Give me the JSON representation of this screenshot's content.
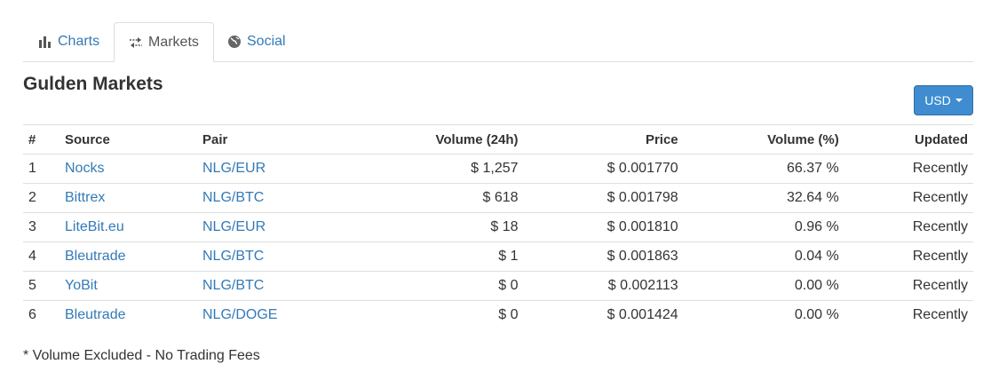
{
  "tabs": [
    {
      "label": "Charts",
      "icon": "bar-chart-icon",
      "active": false
    },
    {
      "label": "Markets",
      "icon": "exchange-arrows-icon",
      "active": true
    },
    {
      "label": "Social",
      "icon": "globe-icon",
      "active": false
    }
  ],
  "heading": "Gulden Markets",
  "currency_button": {
    "label": "USD"
  },
  "table": {
    "headers": [
      "#",
      "Source",
      "Pair",
      "Volume (24h)",
      "Price",
      "Volume (%)",
      "Updated"
    ],
    "rows": [
      {
        "num": "1",
        "source": "Nocks",
        "pair": "NLG/EUR",
        "volume": "$ 1,257",
        "price": "$ 0.001770",
        "volume_pct": "66.37 %",
        "updated": "Recently"
      },
      {
        "num": "2",
        "source": "Bittrex",
        "pair": "NLG/BTC",
        "volume": "$ 618",
        "price": "$ 0.001798",
        "volume_pct": "32.64 %",
        "updated": "Recently"
      },
      {
        "num": "3",
        "source": "LiteBit.eu",
        "pair": "NLG/EUR",
        "volume": "$ 18",
        "price": "$ 0.001810",
        "volume_pct": "0.96 %",
        "updated": "Recently"
      },
      {
        "num": "4",
        "source": "Bleutrade",
        "pair": "NLG/BTC",
        "volume": "$ 1",
        "price": "$ 0.001863",
        "volume_pct": "0.04 %",
        "updated": "Recently"
      },
      {
        "num": "5",
        "source": "YoBit",
        "pair": "NLG/BTC",
        "volume": "$ 0",
        "price": "$ 0.002113",
        "volume_pct": "0.00 %",
        "updated": "Recently"
      },
      {
        "num": "6",
        "source": "Bleutrade",
        "pair": "NLG/DOGE",
        "volume": "$ 0",
        "price": "$ 0.001424",
        "volume_pct": "0.00 %",
        "updated": "Recently"
      }
    ]
  },
  "footnote": "* Volume Excluded - No Trading Fees",
  "colors": {
    "link": "#337ab7",
    "button": "#3f8dd0",
    "border": "#dddddd"
  }
}
